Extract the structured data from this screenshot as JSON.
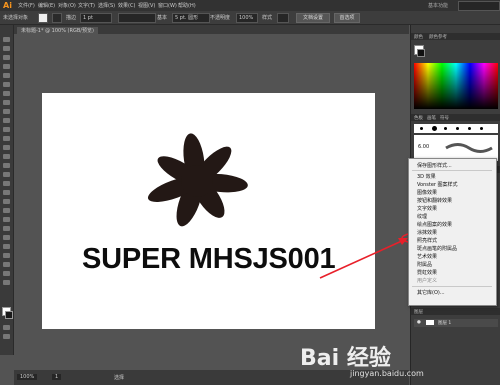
{
  "app": {
    "logo": "Ai",
    "menus": [
      "文件(F)",
      "编辑(E)",
      "对象(O)",
      "文字(T)",
      "选择(S)",
      "效果(C)",
      "视图(V)",
      "窗口(W)",
      "帮助(H)"
    ],
    "workspace": "基本功能"
  },
  "control_bar": {
    "selection": "未选择对象",
    "stroke_label": "描边",
    "stroke_value": "1 pt",
    "brush_label": "基本",
    "point_value": "5 pt. 圆形",
    "opacity_label": "不透明度",
    "opacity_value": "100%",
    "style_label": "样式",
    "doc_setup": "文档设置",
    "prefs": "首选项"
  },
  "document_tab": {
    "title": "未标题-1* @ 100% (RGB/预览)"
  },
  "artboard": {
    "headline": "SUPER MHSJS001"
  },
  "status_bar": {
    "zoom": "100%",
    "page": "1",
    "tool": "选择"
  },
  "panels": {
    "color_tab": "颜色",
    "color_ref_tab": "颜色参考",
    "swatches_tab": "色板",
    "brushes_tab": "画笔",
    "symbols_tab": "符号",
    "stroke_size": "6.00",
    "appearance_tab": "外观",
    "graphic_styles_tab": "图形样式",
    "layers_tab": "图层",
    "layer_name": "图层 1"
  },
  "context_menu": {
    "items": [
      {
        "label": "保存图形样式...",
        "dim": false
      },
      {
        "label": "3D 效果",
        "dim": false
      },
      {
        "label": "Vonster 图案样式",
        "dim": false
      },
      {
        "label": "图像效果",
        "dim": false
      },
      {
        "label": "按钮和翻转效果",
        "dim": false
      },
      {
        "label": "文字效果",
        "dim": false
      },
      {
        "label": "纹理",
        "dim": false
      },
      {
        "label": "绘点图案的效果",
        "dim": false
      },
      {
        "label": "涂抹效果",
        "dim": false
      },
      {
        "label": "照亮样式",
        "dim": false
      },
      {
        "label": "斑点画笔的附属品",
        "dim": false
      },
      {
        "label": "艺术效果",
        "dim": false
      },
      {
        "label": "附属品",
        "dim": false
      },
      {
        "label": "霓虹效果",
        "dim": false
      },
      {
        "label": "用户定义",
        "dim": true
      },
      {
        "label": "其它库(O)...",
        "dim": false
      }
    ]
  },
  "watermark": {
    "brand": "Bai  经验",
    "url": "jingyan.baidu.com"
  }
}
